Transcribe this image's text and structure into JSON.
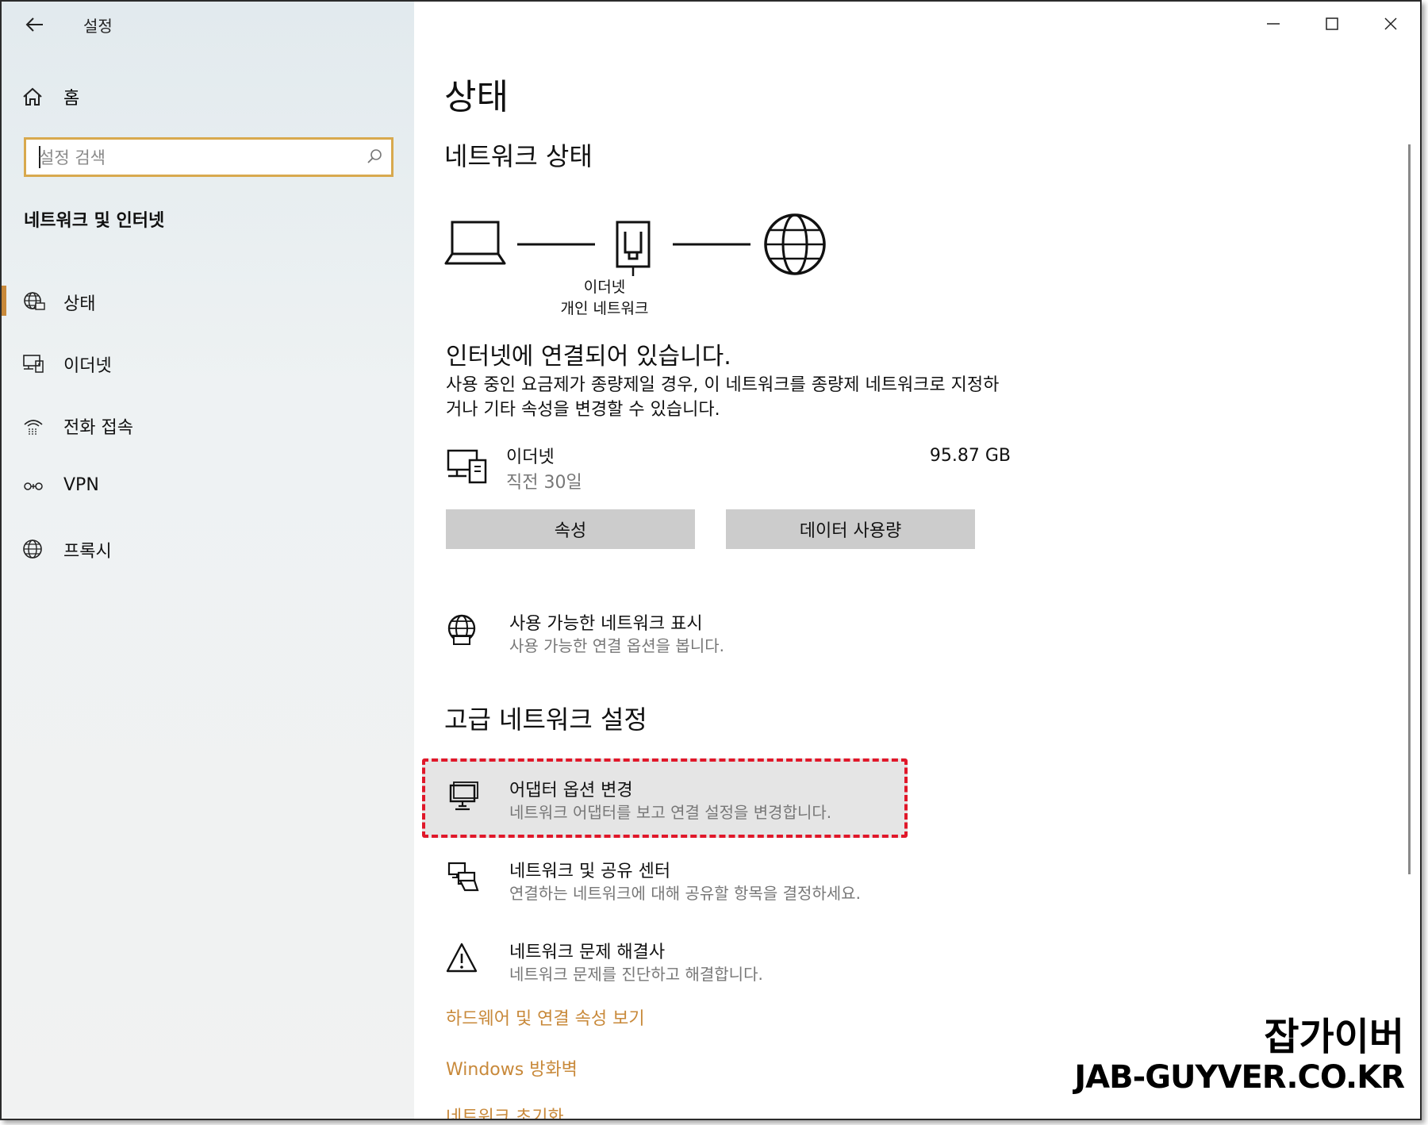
{
  "window": {
    "title": "설정"
  },
  "sidebar": {
    "home_label": "홈",
    "search_placeholder": "설정 검색",
    "section_title": "네트워크 및 인터넷",
    "items": [
      {
        "label": "상태",
        "icon": "globe-status-icon",
        "selected": true
      },
      {
        "label": "이더넷",
        "icon": "ethernet-icon"
      },
      {
        "label": "전화 접속",
        "icon": "dial-up-icon"
      },
      {
        "label": "VPN",
        "icon": "vpn-icon"
      },
      {
        "label": "프록시",
        "icon": "globe-icon"
      }
    ]
  },
  "main": {
    "page_title": "상태",
    "network_status_title": "네트워크 상태",
    "diagram": {
      "line1": "이더넷",
      "line2": "개인 네트워크"
    },
    "connection_status": "인터넷에 연결되어 있습니다.",
    "connection_desc": "사용 중인 요금제가 종량제일 경우, 이 네트워크를 종량제 네트워크로 지정하거나 기타 속성을 변경할 수 있습니다.",
    "adapter": {
      "name": "이더넷",
      "time": "직전 30일",
      "usage": "95.87 GB"
    },
    "buttons": {
      "properties": "속성",
      "data_usage": "데이터 사용량"
    },
    "show_networks": {
      "title": "사용 가능한 네트워크 표시",
      "desc": "사용 가능한 연결 옵션을 봅니다."
    },
    "advanced_title": "고급 네트워크 설정",
    "advanced_items": [
      {
        "title": "어댑터 옵션 변경",
        "desc": "네트워크 어댑터를 보고 연결 설정을 변경합니다."
      },
      {
        "title": "네트워크 및 공유 센터",
        "desc": "연결하는 네트워크에 대해 공유할 항목을 결정하세요."
      },
      {
        "title": "네트워크 문제 해결사",
        "desc": "네트워크 문제를 진단하고 해결합니다."
      }
    ],
    "links": [
      "하드웨어 및 연결 속성 보기",
      "Windows 방화벽",
      "네트워크 초기화"
    ]
  },
  "watermark": {
    "line1": "잡가이버",
    "line2": "JAB-GUYVER.CO.KR"
  },
  "colors": {
    "accent": "#c8893a",
    "search_border": "#d8a94e",
    "highlight": "#e0182a",
    "button": "#cccccc"
  }
}
